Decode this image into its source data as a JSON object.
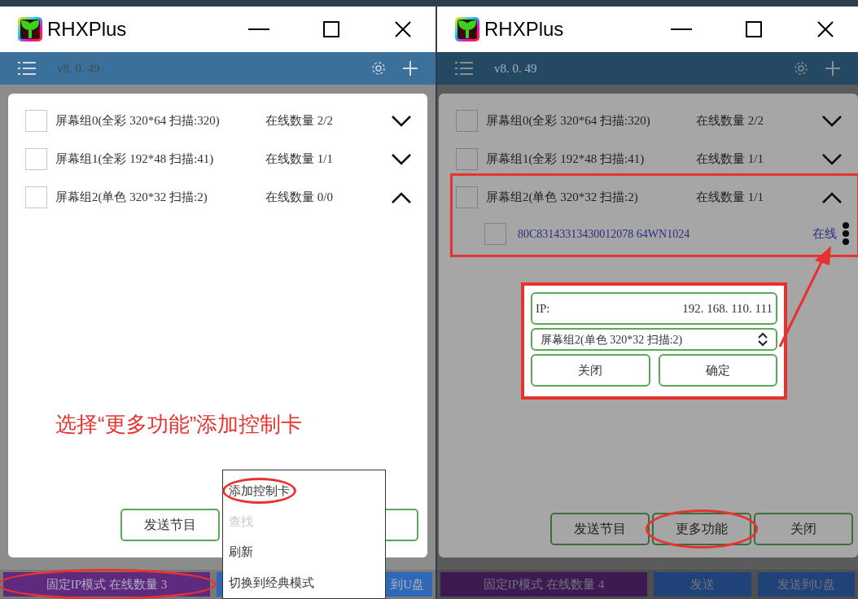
{
  "windows": [
    {
      "title": "RHXPlus",
      "version": "v8. 0. 49",
      "dimmed": false,
      "groups": [
        {
          "label": "屏幕组0(全彩 320*64 扫描:320)",
          "online": "在线数量 2/2",
          "checked": false,
          "expanded": false,
          "highlighted": false
        },
        {
          "label": "屏幕组1(全彩 192*48 扫描:41)",
          "online": "在线数量 1/1",
          "checked": false,
          "expanded": false,
          "highlighted": false
        },
        {
          "label": "屏幕组2(单色 320*32 扫描:2)",
          "online": "在线数量 0/0",
          "checked": false,
          "expanded": true,
          "highlighted": false
        }
      ],
      "note": "选择“更多功能”添加控制卡",
      "buttons": [
        {
          "label": "发送节目",
          "circled": false
        },
        {
          "circled": false
        }
      ],
      "status": [
        {
          "kind": "mode",
          "label": "固定IP模式 在线数量 3",
          "circled": true
        },
        {
          "kind": "send",
          "circled": false
        },
        {
          "kind": "send",
          "label": "到U盘",
          "circled": false
        }
      ],
      "menu": [
        {
          "label": "添加控制卡",
          "disabled": false,
          "circled": true
        },
        {
          "label": "查找",
          "disabled": true,
          "circled": false
        },
        {
          "label": "刷新",
          "disabled": false,
          "circled": false
        },
        {
          "label": "切换到经典模式",
          "disabled": false,
          "circled": false
        }
      ]
    },
    {
      "title": "RHXPlus",
      "version": "v8. 0. 49",
      "dimmed": true,
      "groups": [
        {
          "label": "屏幕组0(全彩 320*64 扫描:320)",
          "online": "在线数量 2/2",
          "checked": false,
          "expanded": false,
          "highlighted": false
        },
        {
          "label": "屏幕组1(全彩 192*48 扫描:41)",
          "online": "在线数量 1/1",
          "checked": false,
          "expanded": false,
          "highlighted": false
        },
        {
          "label": "屏幕组2(单色 320*32 扫描:2)",
          "online": "在线数量 1/1",
          "checked": false,
          "expanded": true,
          "highlighted": true,
          "devices": [
            {
              "id": "80C83143313430012078 64WN1024",
              "status": "在线",
              "checked": false
            }
          ]
        }
      ],
      "dialog": {
        "ip_label": "IP:",
        "ip_value": "192. 168. 110. 111",
        "group": "屏幕组2(单色 320*32 扫描:2)",
        "buttons": [
          "关闭",
          "确定"
        ]
      },
      "buttons": [
        {
          "label": "发送节目",
          "circled": false
        },
        {
          "label": "更多功能",
          "circled": true
        },
        {
          "label": "关闭",
          "circled": false
        }
      ],
      "status": [
        {
          "kind": "mode",
          "label": "固定IP模式 在线数量 4",
          "circled": false
        },
        {
          "kind": "send",
          "label": "发送",
          "circled": false
        },
        {
          "kind": "send",
          "label": "发送到U盘",
          "circled": false
        }
      ]
    }
  ]
}
